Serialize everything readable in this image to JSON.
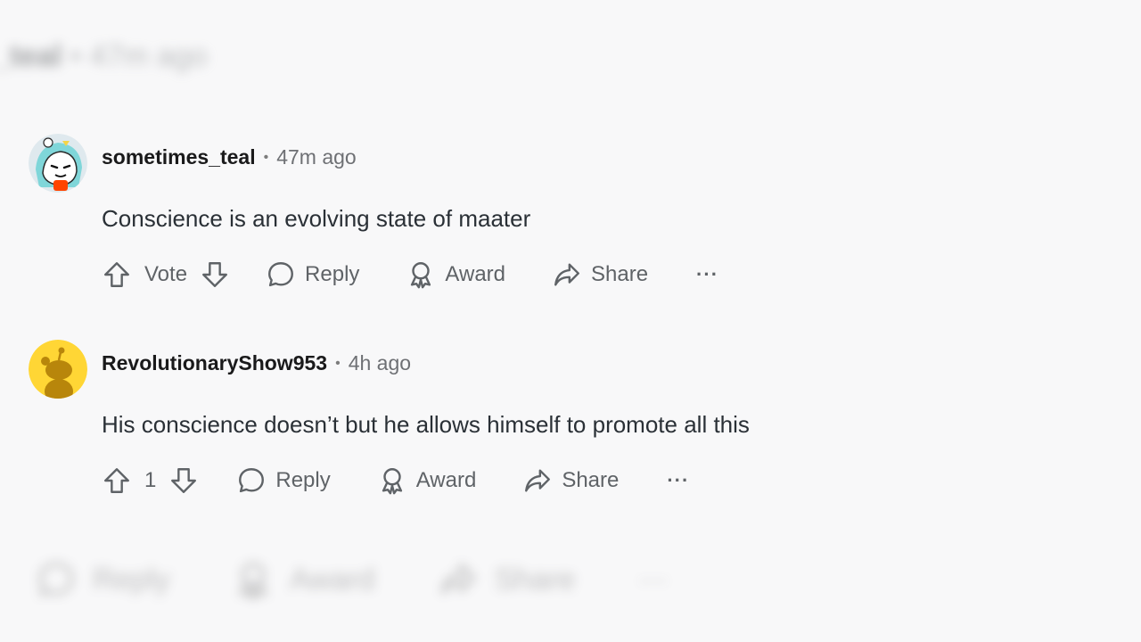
{
  "context_top": {
    "username": "_teal",
    "time": "47m ago"
  },
  "comments": [
    {
      "username": "sometimes_teal",
      "separator": "•",
      "time": "47m ago",
      "text": "Conscience is an evolving state of maater",
      "vote_label": "Vote",
      "reply_label": "Reply",
      "award_label": "Award",
      "share_label": "Share",
      "more_label": "···"
    },
    {
      "username": "RevolutionaryShow953",
      "separator": "•",
      "time": "4h ago",
      "text": "His conscience doesn’t but he allows himself to promote all this",
      "vote_label": "1",
      "reply_label": "Reply",
      "award_label": "Award",
      "share_label": "Share",
      "more_label": "···"
    }
  ],
  "context_bottom": {
    "reply_label": "Reply",
    "award_label": "Award",
    "share_label": "Share",
    "more_label": "···"
  },
  "colors": {
    "background": "#f8f8f9",
    "text": "#2a3036",
    "muted": "#5f6367",
    "avatar_yellow": "#ffd635"
  }
}
